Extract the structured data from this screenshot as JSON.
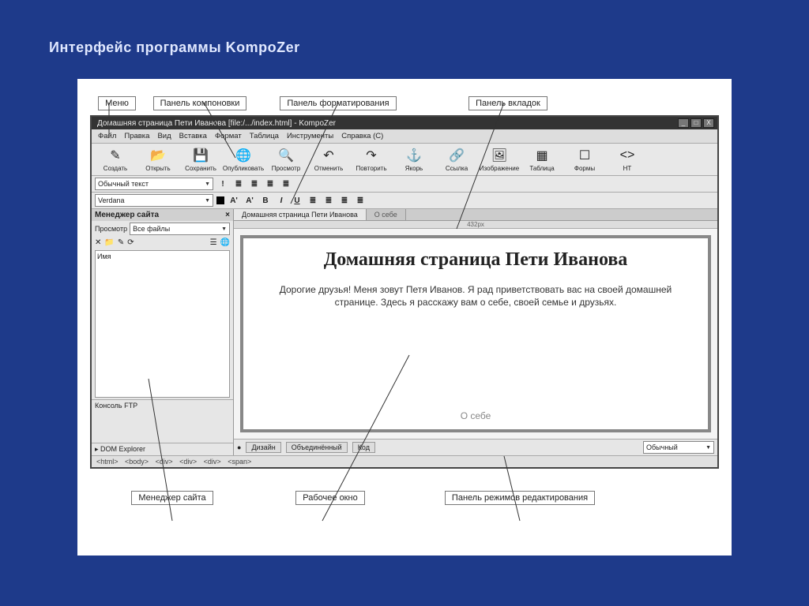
{
  "slide": {
    "title": "Интерфейс программы KompoZer"
  },
  "callouts": {
    "menu": "Меню",
    "layout_panel": "Панель компоновки",
    "format_panel": "Панель форматирования",
    "tab_panel": "Панель вкладок",
    "site_manager": "Менеджер сайта",
    "work_window": "Рабочее окно",
    "edit_modes_panel": "Панель режимов редактирования"
  },
  "window": {
    "title": "Домашняя страница Пети Иванова [file:/.../index.html] - KompoZer",
    "min": "_",
    "max": "□",
    "close": "X"
  },
  "menu": [
    "Файл",
    "Правка",
    "Вид",
    "Вставка",
    "Формат",
    "Таблица",
    "Инструменты",
    "Справка (C)"
  ],
  "toolbar": [
    {
      "label": "Создать",
      "icon": "✎"
    },
    {
      "label": "Открыть",
      "icon": "📂"
    },
    {
      "label": "Сохранить",
      "icon": "💾"
    },
    {
      "label": "Опубликовать",
      "icon": "🌐"
    },
    {
      "label": "Просмотр",
      "icon": "🔍"
    },
    {
      "label": "Отменить",
      "icon": "↶"
    },
    {
      "label": "Повторить",
      "icon": "↷"
    },
    {
      "label": "Якорь",
      "icon": "⚓"
    },
    {
      "label": "Ссылка",
      "icon": "🔗"
    },
    {
      "label": "Изображение",
      "icon": "🖼"
    },
    {
      "label": "Таблица",
      "icon": "▦"
    },
    {
      "label": "Формы",
      "icon": "☐"
    },
    {
      "label": "HT",
      "icon": "<>"
    }
  ],
  "format": {
    "para_style": "Обычный текст",
    "font": "Verdana",
    "buttons": [
      "A'",
      "A'",
      "B",
      "I",
      "U",
      "≣",
      "≣",
      "≣",
      "≣"
    ]
  },
  "sidebar": {
    "title": "Менеджер сайта",
    "view_label": "Просмотр",
    "view_value": "Все файлы",
    "icons": [
      "✕",
      "📁",
      "✎",
      "⟳",
      "☰",
      "🌐"
    ],
    "tree_header": "Имя",
    "console": "Консоль FTP",
    "dom": "DOM Explorer"
  },
  "tabs": {
    "active": "Домашняя страница Пети Иванова",
    "inactive": "О себе"
  },
  "ruler": "432px",
  "page": {
    "heading": "Домашняя страница Пети Иванова",
    "body": "Дорогие друзья! Меня зовут Петя Иванов. Я рад приветствовать вас на своей домашней странице. Здесь я расскажу вам о себе, своей семье и друзьях.",
    "link": "О себе"
  },
  "view_modes": {
    "design": "Дизайн",
    "split": "Объединённый",
    "code": "Код",
    "normal": "Обычный"
  },
  "tag_path": [
    "<html>",
    "<body>",
    "<div>",
    "<div>",
    "<div>",
    "<span>"
  ]
}
